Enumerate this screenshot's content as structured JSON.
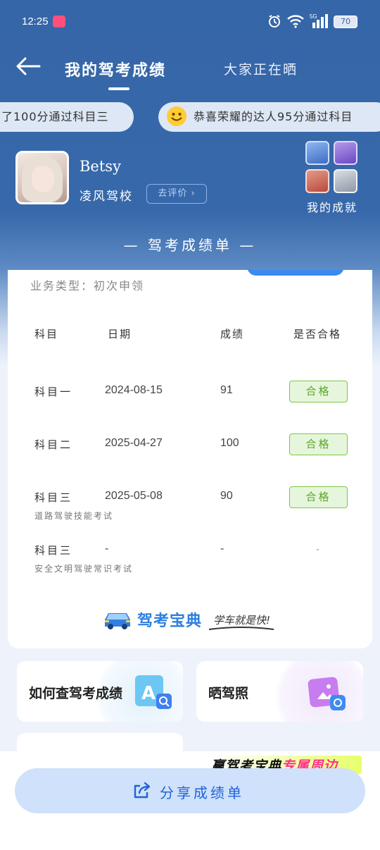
{
  "status_bar": {
    "time": "12:25",
    "battery": "70"
  },
  "nav": {
    "tab_active": "我的驾考成绩",
    "tab_other": "大家正在晒"
  },
  "ticker": {
    "item1": "了100分通过科目三",
    "item2": "恭喜荣耀的达人95分通过科目"
  },
  "profile": {
    "name": "Betsy",
    "school": "凌风驾校",
    "review_button": "去评价",
    "achievements_label": "我的成就"
  },
  "sheet_title": "— 驾考成绩单 —",
  "scorecard": {
    "business_type": "业务类型：初次申领",
    "headers": [
      "科目",
      "日期",
      "成绩",
      "是否合格"
    ],
    "rows": [
      {
        "subject": "科目一",
        "date": "2024-08-15",
        "score": "91",
        "result": "合格",
        "note": ""
      },
      {
        "subject": "科目二",
        "date": "2025-04-27",
        "score": "100",
        "result": "合格",
        "note": ""
      },
      {
        "subject": "科目三",
        "date": "2025-05-08",
        "score": "90",
        "result": "合格",
        "note": "道路驾驶技能考试"
      },
      {
        "subject": "科目三",
        "date": "-",
        "score": "-",
        "result": "-",
        "note": "安全文明驾驶常识考试"
      }
    ]
  },
  "brand": {
    "name": "驾考宝典",
    "slogan": "学车就是快!"
  },
  "quick_links": {
    "item1": "如何查驾考成绩",
    "item2": "晒驾照"
  },
  "promo": {
    "part1": "赢驾考宝典",
    "part2": "专属周边"
  },
  "share_button": "分享成绩单",
  "colors": {
    "primary_blue": "#3566a8",
    "accent_blue": "#2f7fe0",
    "pass_green": "#5aa52b",
    "pass_bg": "#e6f6dc"
  }
}
